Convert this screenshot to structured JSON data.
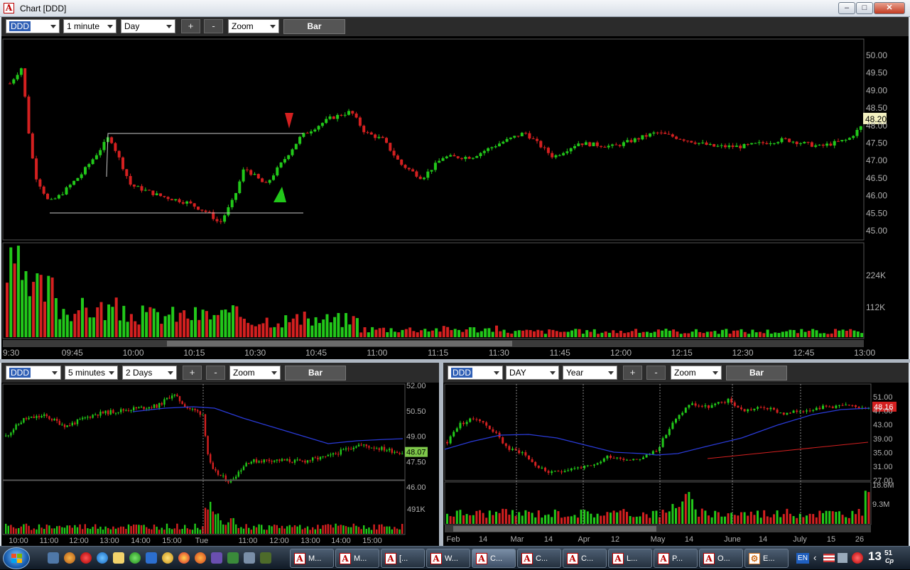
{
  "window": {
    "title": "Chart [DDD]",
    "minimize": "–",
    "maximize": "□",
    "close": "✕"
  },
  "main": {
    "symbol": "DDD",
    "interval": "1 minute",
    "range": "Day",
    "plus": "+",
    "minus": "-",
    "zoom": "Zoom",
    "style": "Bar",
    "price_labels": [
      "50.00",
      "49.50",
      "49.00",
      "48.50",
      "48.00",
      "47.50",
      "47.00",
      "46.50",
      "46.00",
      "45.50",
      "45.00"
    ],
    "last_price": "48.20",
    "volume_labels": [
      "224K",
      "112K"
    ],
    "time_labels": [
      "9:30",
      "09:45",
      "10:00",
      "10:15",
      "10:30",
      "10:45",
      "11:00",
      "11:15",
      "11:30",
      "11:45",
      "12:00",
      "12:15",
      "12:30",
      "12:45",
      "13:00"
    ]
  },
  "bottom_left": {
    "symbol": "DDD",
    "interval": "5 minutes",
    "range": "2 Days",
    "plus": "+",
    "minus": "-",
    "zoom": "Zoom",
    "style": "Bar",
    "price_labels": [
      "52.00",
      "50.50",
      "49.00",
      "47.50",
      "46.00"
    ],
    "last_price": "48.07",
    "volume_label": "491K",
    "time_labels": [
      "10:00",
      "11:00",
      "12:00",
      "13:00",
      "14:00",
      "15:00",
      "Tue",
      "11:00",
      "12:00",
      "13:00",
      "14:00",
      "15:00"
    ]
  },
  "bottom_right": {
    "symbol": "DDD",
    "interval": "DAY",
    "range": "Year",
    "plus": "+",
    "minus": "-",
    "zoom": "Zoom",
    "style": "Bar",
    "price_labels": [
      "51.00",
      "47.00",
      "43.00",
      "39.00",
      "35.00",
      "31.00",
      "27.00"
    ],
    "last_price": "48.16",
    "volume_labels": [
      "18.6M",
      "9.3M"
    ],
    "time_labels": [
      "Feb",
      "14",
      "Mar",
      "14",
      "Apr",
      "12",
      "May",
      "14",
      "June",
      "14",
      "July",
      "15",
      "26"
    ]
  },
  "taskbar": {
    "tasks": [
      "M...",
      "M...",
      "[...",
      "W...",
      "C...",
      "C...",
      "C...",
      "L...",
      "P...",
      "O...",
      "E..."
    ],
    "language": "EN",
    "clock_hour": "13",
    "clock_min": "51",
    "clock_suffix": "Cp"
  },
  "colors": {
    "up": "#22c81a",
    "down": "#d42020",
    "grid_label": "#b0b0b0",
    "ma_line": "#2a3bd8",
    "toolbar_bg": "#2b2b2b"
  }
}
